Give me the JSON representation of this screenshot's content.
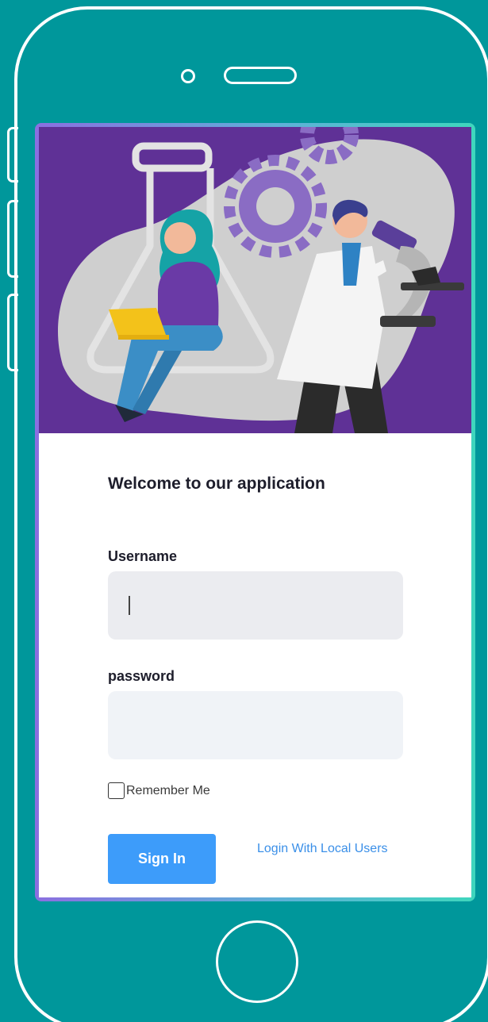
{
  "login": {
    "welcome_title": "Welcome to our application",
    "username_label": "Username",
    "username_value": "",
    "password_label": "password",
    "password_value": "",
    "remember_label": "Remember Me",
    "remember_checked": false,
    "signin_label": "Sign In",
    "local_users_link": "Login With Local Users"
  },
  "colors": {
    "background": "#00979b",
    "hero_purple": "#5f3196",
    "primary_button": "#3d9cfa",
    "link": "#3a8fe8"
  },
  "icons": [
    "lab-illustration",
    "gear-icon",
    "flask-icon",
    "laptop-icon",
    "microscope-icon"
  ]
}
